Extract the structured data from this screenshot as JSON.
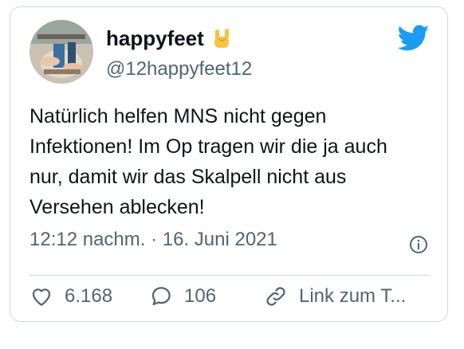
{
  "tweet": {
    "display_name": "happyfeet",
    "emoji_icon": "sign-of-horns-emoji",
    "handle": "@12happyfeet12",
    "text": "Natürlich helfen MNS nicht gegen\nInfektionen! Im Op tragen wir die ja auch\nnur, damit wir das Skalpell nicht aus\nVersehen ablecken!",
    "timestamp": "12:12 nachm. · 16. Juni 2021",
    "likes": "6.168",
    "replies": "106",
    "link_label": "Link zum T..."
  },
  "colors": {
    "twitter_blue": "#1d9bf0",
    "secondary_text": "#536471",
    "border": "#cfd9de"
  }
}
